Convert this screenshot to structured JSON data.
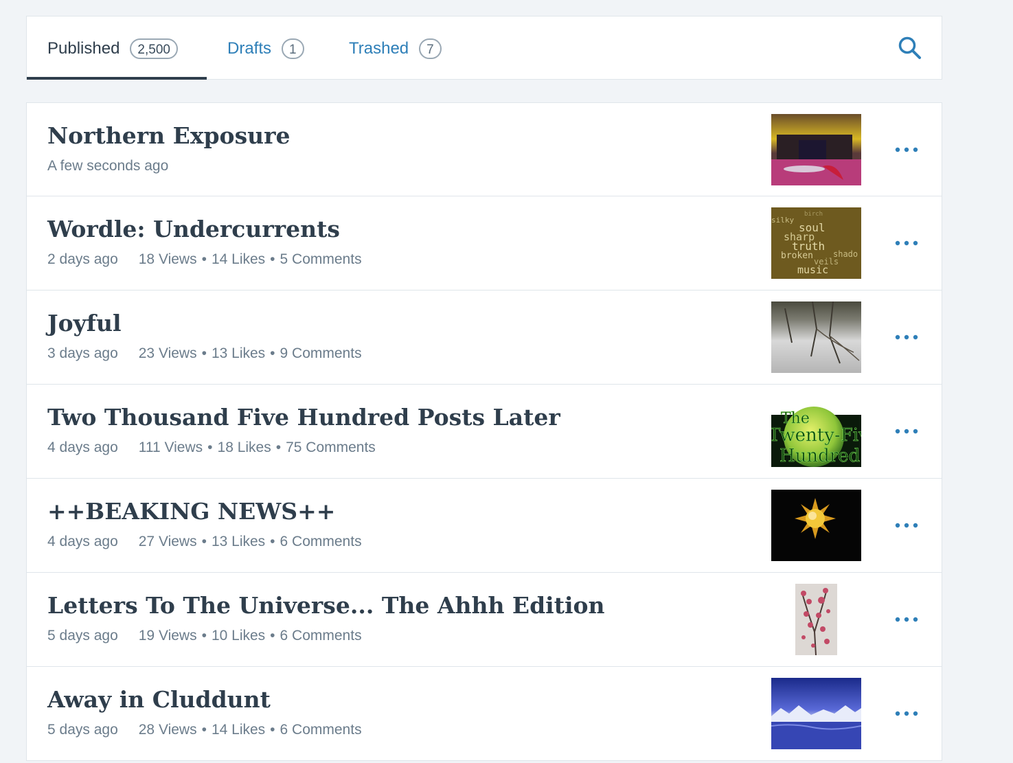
{
  "tabs": [
    {
      "label": "Published",
      "count": "2,500"
    },
    {
      "label": "Drafts",
      "count": "1"
    },
    {
      "label": "Trashed",
      "count": "7"
    }
  ],
  "colors": {
    "accent": "#2e7fb8",
    "text": "#2f3e4c",
    "meta": "#6b7c8b",
    "background": "#f1f4f7"
  },
  "icons": {
    "search": "search-icon",
    "more": "more-icon"
  },
  "posts": [
    {
      "title": "Northern Exposure",
      "date": "A few seconds ago"
    },
    {
      "title": "Wordle: Undercurrents",
      "date": "2 days ago",
      "views": "18 Views",
      "likes": "14 Likes",
      "comments": "5 Comments",
      "thumb_words": [
        "birch",
        "silky",
        "soul",
        "sharp",
        "truth",
        "broken",
        "shado",
        "veils",
        "music"
      ]
    },
    {
      "title": "Joyful",
      "date": "3 days ago",
      "views": "23 Views",
      "likes": "13 Likes",
      "comments": "9 Comments"
    },
    {
      "title": "Two Thousand Five Hundred Posts Later",
      "date": "4 days ago",
      "views": "111 Views",
      "likes": "18 Likes",
      "comments": "75 Comments",
      "thumb_words": [
        "The",
        "Twenty-Five",
        "Hundred"
      ]
    },
    {
      "title": "++BEAKING NEWS++",
      "date": "4 days ago",
      "views": "27 Views",
      "likes": "13 Likes",
      "comments": "6 Comments"
    },
    {
      "title": "Letters To The Universe... The Ahhh Edition",
      "date": "5 days ago",
      "views": "19 Views",
      "likes": "10 Likes",
      "comments": "6 Comments"
    },
    {
      "title": "Away in Cluddunt",
      "date": "5 days ago",
      "views": "28 Views",
      "likes": "14 Likes",
      "comments": "6 Comments"
    }
  ]
}
